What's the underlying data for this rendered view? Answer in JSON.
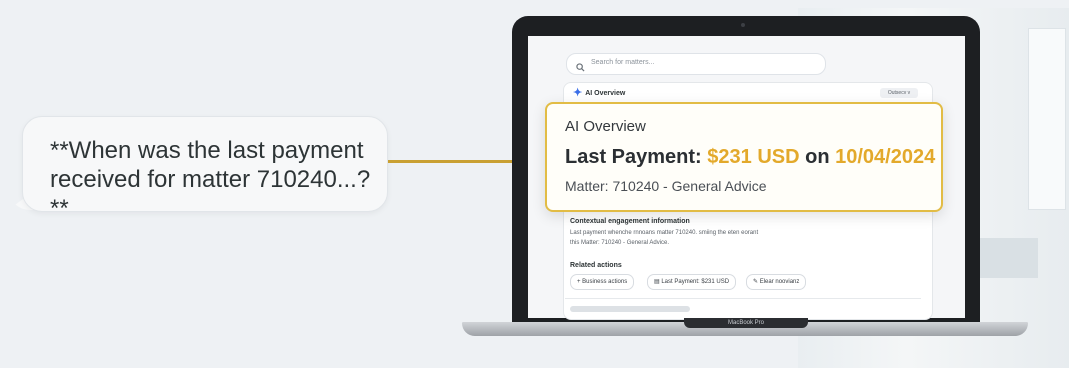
{
  "colors": {
    "accent_gold": "#e3a92b",
    "arrow": "#c9a032",
    "sparkle_blue": "#3a6ee8"
  },
  "bubble": {
    "text": "**When was the last payment received for matter 710240...?**"
  },
  "laptop": {
    "brand": "MacBook Pro"
  },
  "app": {
    "search": {
      "placeholder": "Search for matters...",
      "icon": "search-icon"
    },
    "overview_header": {
      "label": "AI Overview",
      "icon": "sparkle-icon",
      "dropdown": "Outsecv v"
    },
    "card": {
      "title": "AI Overview",
      "prefix": "Last Payment:",
      "amount": "$231 USD",
      "on": "on",
      "date": "10/04/2024",
      "matter": "Matter: 710240 - General Advice"
    },
    "context": {
      "title": "Contextual engagement information",
      "line1": "Last payment whenche rnnoans matter 710240. smiing the eten eorant",
      "line2": "this Matter: 710240 - General Advice."
    },
    "related": {
      "title": "Related actions",
      "chips": [
        {
          "label": "Business actions",
          "icon": "plus-icon"
        },
        {
          "label": "Last Payment: $231 USD",
          "icon": "receipt-icon"
        },
        {
          "label": "Elear noovianz",
          "icon": "pencil-icon"
        }
      ]
    }
  }
}
